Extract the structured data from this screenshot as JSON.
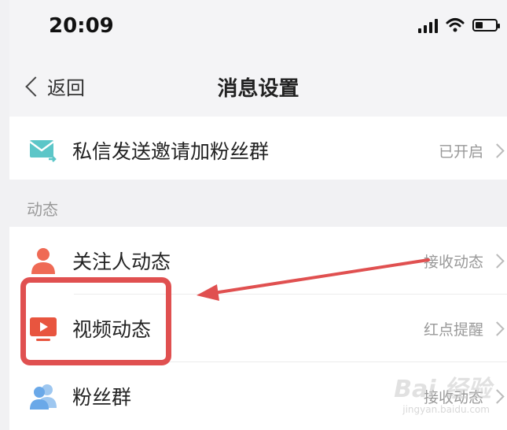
{
  "status_bar": {
    "time": "20:09",
    "icons": [
      "signal-icon",
      "wifi-icon",
      "battery-icon"
    ]
  },
  "nav": {
    "back_label": "返回",
    "title": "消息设置"
  },
  "rows_top": [
    {
      "icon": "mail-forward-icon",
      "label": "私信发送邀请加粉丝群",
      "value": "已开启"
    }
  ],
  "section": {
    "title": "动态"
  },
  "rows_dynamic": [
    {
      "icon": "person-icon",
      "label": "关注人动态",
      "value": "接收动态"
    },
    {
      "icon": "video-play-icon",
      "label": "视频动态",
      "value": "红点提醒"
    },
    {
      "icon": "fan-group-icon",
      "label": "粉丝群",
      "value": "接收动态"
    }
  ],
  "watermark": {
    "main": "Bai 经验",
    "sub": "jingyan.baidu.com"
  },
  "colors": {
    "highlight": "#e05050",
    "mail_icon": "#5cc6c8",
    "person_icon": "#ef6a55",
    "video_icon": "#e8553f",
    "fans_icon": "#6aa8e8"
  }
}
